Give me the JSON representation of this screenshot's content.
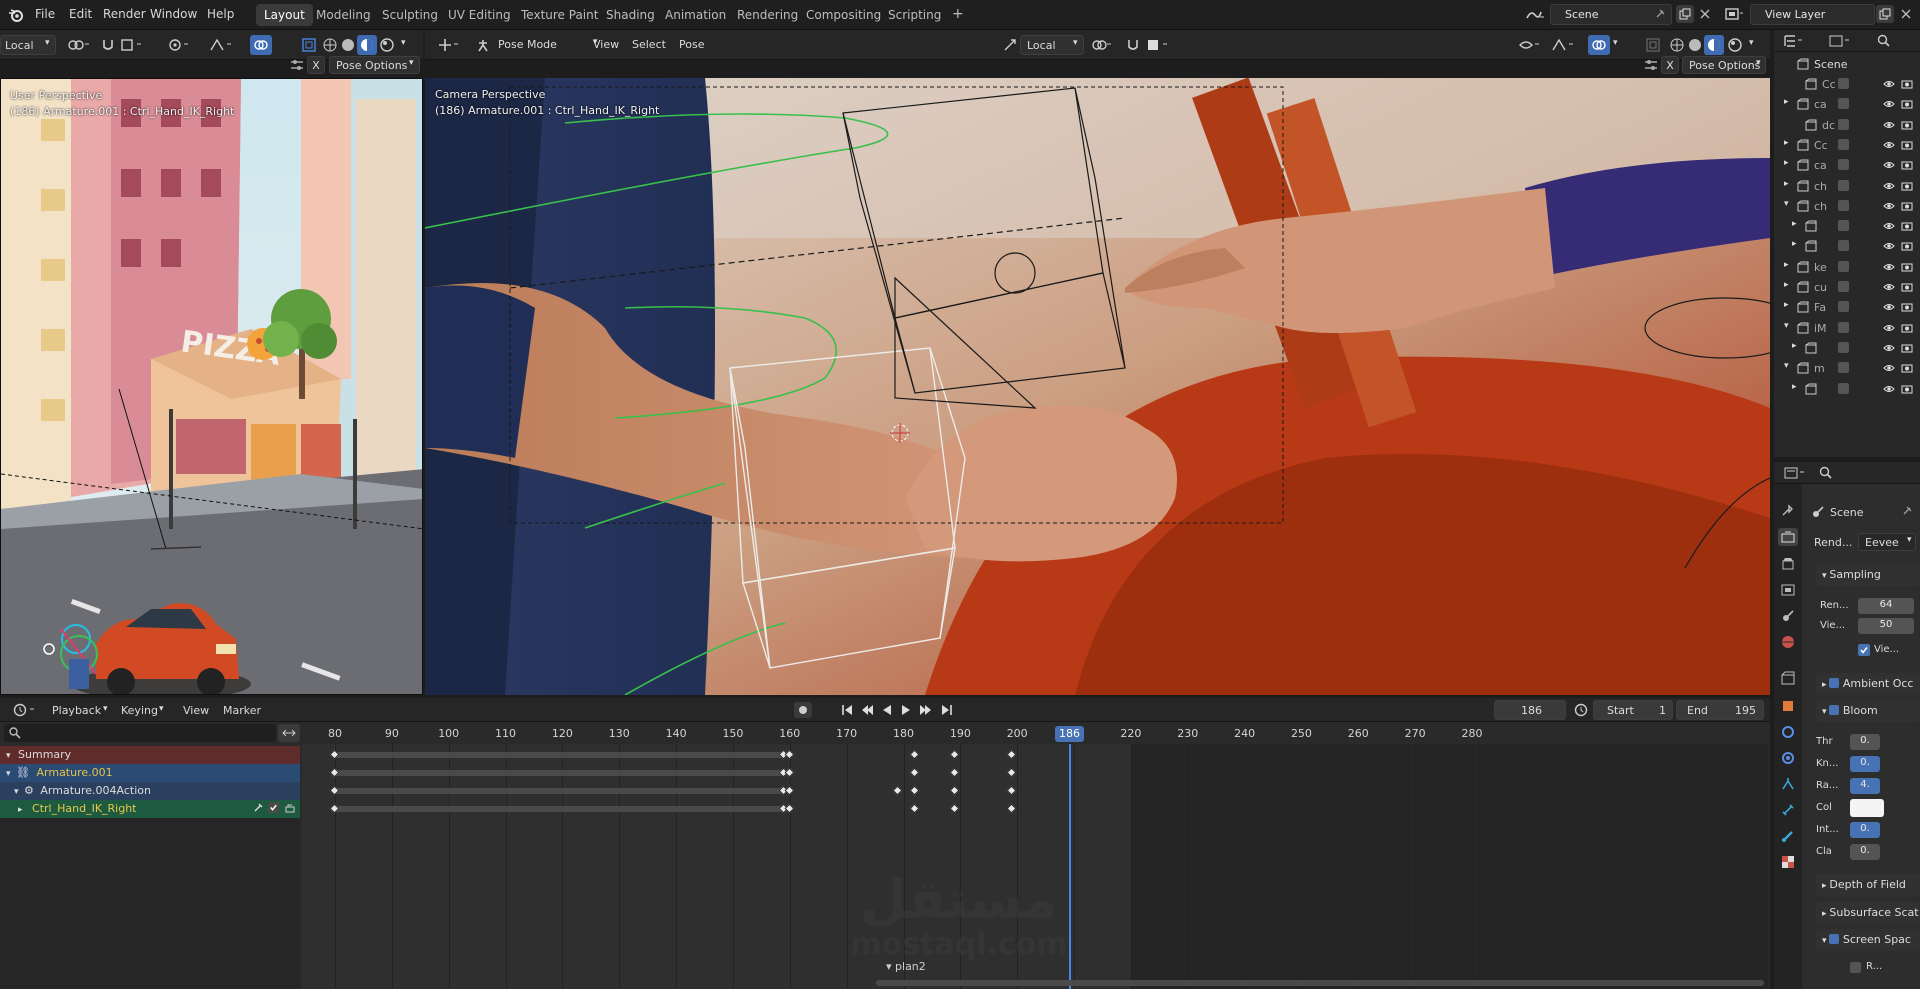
{
  "topbar": {
    "menus": [
      "File",
      "Edit",
      "Render",
      "Window",
      "Help"
    ],
    "workspaces": [
      "Layout",
      "Modeling",
      "Sculpting",
      "UV Editing",
      "Texture Paint",
      "Shading",
      "Animation",
      "Rendering",
      "Compositing",
      "Scripting"
    ],
    "active_workspace": "Layout",
    "add_workspace": "+",
    "scene_name": "Scene",
    "view_layer": "View Layer"
  },
  "left_header": {
    "orientation": "Local",
    "pose_options": "Pose Options",
    "close": "X"
  },
  "left_viewport": {
    "perspective": "User Perspective",
    "object": "(186) Armature.001 : Ctrl_Hand_IK_Right",
    "sign_text": "PIZZA"
  },
  "main_header": {
    "mode": "Pose Mode",
    "menus": [
      "View",
      "Select",
      "Pose"
    ],
    "orientation": "Local",
    "pose_options": "Pose Options",
    "close": "X"
  },
  "main_viewport": {
    "perspective": "Camera Perspective",
    "object": "(186) Armature.001 : Ctrl_Hand_IK_Right"
  },
  "outliner": {
    "root": "Scene",
    "rows": [
      {
        "label": "Cc",
        "expand": ""
      },
      {
        "label": "ca",
        "expand": "▸"
      },
      {
        "label": "dc",
        "expand": ""
      },
      {
        "label": "Cc",
        "expand": "▸"
      },
      {
        "label": "ca",
        "expand": "▸"
      },
      {
        "label": "ch",
        "expand": "▸"
      },
      {
        "label": "ch",
        "expand": "▾"
      },
      {
        "label": "",
        "expand": "▸"
      },
      {
        "label": "",
        "expand": "▸"
      },
      {
        "label": "ke",
        "expand": "▸"
      },
      {
        "label": "cu",
        "expand": "▸"
      },
      {
        "label": "Fa",
        "expand": "▸"
      },
      {
        "label": "iM",
        "expand": "▾"
      },
      {
        "label": "",
        "expand": "▸"
      },
      {
        "label": "m",
        "expand": "▾"
      },
      {
        "label": "",
        "expand": "▸"
      }
    ]
  },
  "properties": {
    "context": "Scene",
    "render_engine_label": "Rend...",
    "render_engine": "Eevee",
    "sections": [
      {
        "label": "Sampling",
        "expanded": true,
        "checkbox": false
      },
      {
        "label": "Ambient Occ",
        "expanded": false,
        "checkbox": true
      },
      {
        "label": "Bloom",
        "expanded": true,
        "checkbox": true
      },
      {
        "label": "Depth of Field",
        "expanded": false,
        "checkbox": false
      },
      {
        "label": "Subsurface Scat",
        "expanded": false,
        "checkbox": false
      },
      {
        "label": "Screen Spac",
        "expanded": true,
        "checkbox": true
      }
    ],
    "sampling": {
      "render_label": "Ren...",
      "render_value": "64",
      "viewport_label": "Vie...",
      "viewport_value": "50",
      "denoise_label": "Vie..."
    },
    "bloom": [
      {
        "label": "Thr",
        "value": "0."
      },
      {
        "label": "Kn...",
        "value": "0."
      },
      {
        "label": "Ra...",
        "value": "4."
      },
      {
        "label": "Col",
        "value": ""
      },
      {
        "label": "Int...",
        "value": "0."
      },
      {
        "label": "Cla",
        "value": "0."
      }
    ],
    "ssr_sub": "R..."
  },
  "timeline": {
    "menus": [
      "Playback",
      "Keying",
      "View",
      "Marker"
    ],
    "current_frame": "186",
    "start_label": "Start",
    "start": "1",
    "end_label": "End",
    "end": "195",
    "ticks": [
      "80",
      "90",
      "100",
      "110",
      "120",
      "130",
      "140",
      "150",
      "160",
      "170",
      "180",
      "190",
      "200",
      "210",
      "220",
      "230",
      "240",
      "250",
      "260",
      "270",
      "280"
    ],
    "channels": [
      "Summary",
      "Armature.001",
      "Armature.004Action",
      "Ctrl_Hand_IK_Right"
    ],
    "marker": "plan2",
    "keyframes": [
      {
        "row": 0,
        "frames": [
          80,
          159,
          160,
          182,
          189,
          199
        ]
      },
      {
        "row": 1,
        "frames": [
          80,
          159,
          160,
          182,
          189,
          199
        ]
      },
      {
        "row": 2,
        "frames": [
          80,
          159,
          160,
          179,
          182,
          189,
          199
        ]
      },
      {
        "row": 3,
        "frames": [
          80,
          159,
          160,
          182,
          189,
          199
        ]
      }
    ]
  },
  "watermark": {
    "arabic": "مستقل",
    "latin": "mostaql.com"
  },
  "colors": {
    "accent": "#4772b3",
    "summary_row": "#6a2a2a",
    "armature_row": "#2d4a6e",
    "bone_row": "#1f5a42",
    "bone_text": "#e6c84a",
    "current_frame": "#3d6fc2"
  }
}
